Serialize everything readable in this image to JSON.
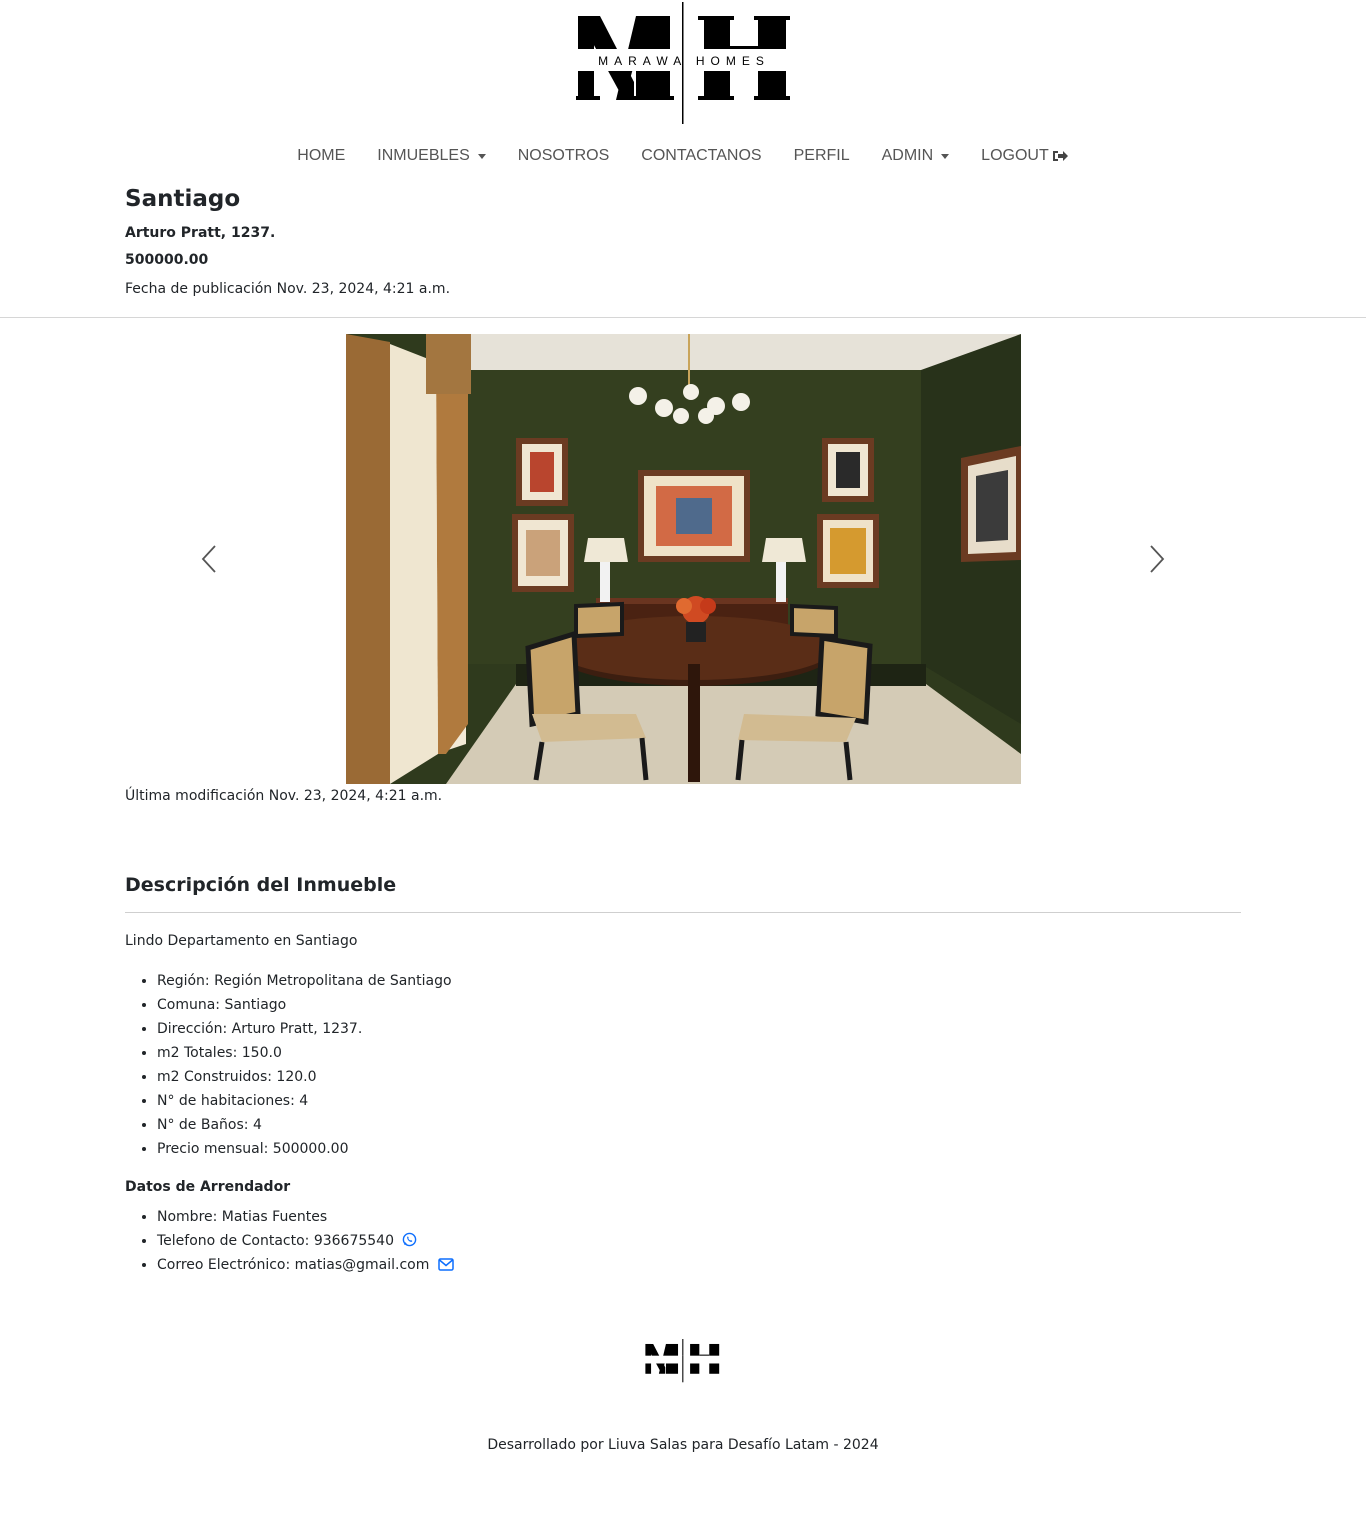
{
  "brand": {
    "logo_letters": "MH",
    "logo_text": "MARAWA HOMES"
  },
  "nav": {
    "items": [
      {
        "label": "HOME",
        "dropdown": false
      },
      {
        "label": "INMUEBLES",
        "dropdown": true
      },
      {
        "label": "NOSOTROS",
        "dropdown": false
      },
      {
        "label": "CONTACTANOS",
        "dropdown": false
      },
      {
        "label": "PERFIL",
        "dropdown": false
      },
      {
        "label": "ADMIN",
        "dropdown": true
      },
      {
        "label": "LOGOUT",
        "dropdown": false,
        "icon": "sign-out-icon"
      }
    ]
  },
  "property": {
    "title": "Santiago",
    "address": "Arturo Pratt, 1237.",
    "price": "500000.00",
    "published": "Fecha de publicación Nov. 23, 2024, 4:21 a.m.",
    "modified": "Última modificación Nov. 23, 2024, 4:21 a.m."
  },
  "carousel": {
    "image_alt": "dining-room-photo",
    "prev_icon": "chevron-left-icon",
    "next_icon": "chevron-right-icon"
  },
  "description": {
    "heading": "Descripción del Inmueble",
    "text": "Lindo Departamento en Santiago",
    "facts": [
      "Región: Región Metropolitana de Santiago",
      "Comuna: Santiago",
      "Dirección: Arturo Pratt, 1237.",
      "m2 Totales: 150.0",
      "m2 Construidos: 120.0",
      "N° de habitaciones: 4",
      "N° de Baños: 4",
      "Precio mensual: 500000.00"
    ]
  },
  "owner": {
    "heading": "Datos de Arrendador",
    "name": "Nombre: Matias Fuentes",
    "phone": "Telefono de Contacto: 936675540",
    "email": "Correo Electrónico: matias@gmail.com",
    "phone_icon": "whatsapp-icon",
    "email_icon": "envelope-icon",
    "icon_color": "#0d6efd"
  },
  "footer": {
    "credit": "Desarrollado por Liuva Salas para Desafío Latam - 2024"
  }
}
